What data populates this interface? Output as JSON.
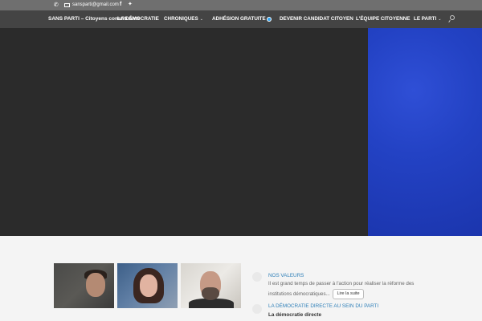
{
  "topbar": {
    "email": "sansparti@gmail.com"
  },
  "icons": {
    "phone": "phone-icon",
    "email": "envelope-icon",
    "facebook": "facebook-icon",
    "twitter": "twitter-icon",
    "search": "search-icon"
  },
  "navbar": {
    "brand": "SANS PARTI – Citoyens constituants",
    "items": [
      {
        "label": "LA DÉMOCRATIE"
      },
      {
        "label": "CHRONIQUES"
      },
      {
        "label": "ADHÉSION GRATUITE"
      },
      {
        "label": "DEVENIR CANDIDAT CITOYEN"
      },
      {
        "label": "L'ÉQUIPE CITOYENNE"
      },
      {
        "label": "LE PARTI"
      }
    ]
  },
  "colors": {
    "accent": "#2ea3f2",
    "hero_dark": "#2b2b2b",
    "hero_blue": "#2342c4",
    "link": "#2e7fb8"
  },
  "sections": {
    "values": {
      "title": "NOS VALEURS",
      "text": "Il est grand temps de passer à l'action pour réaliser la réforme des institutions démocratiques...",
      "button": "Lire la suite"
    },
    "direct": {
      "title": "LA DÉMOCRATIE DIRECTE AU SEIN DU PARTI",
      "subtitle": "La démocratie directe"
    }
  }
}
